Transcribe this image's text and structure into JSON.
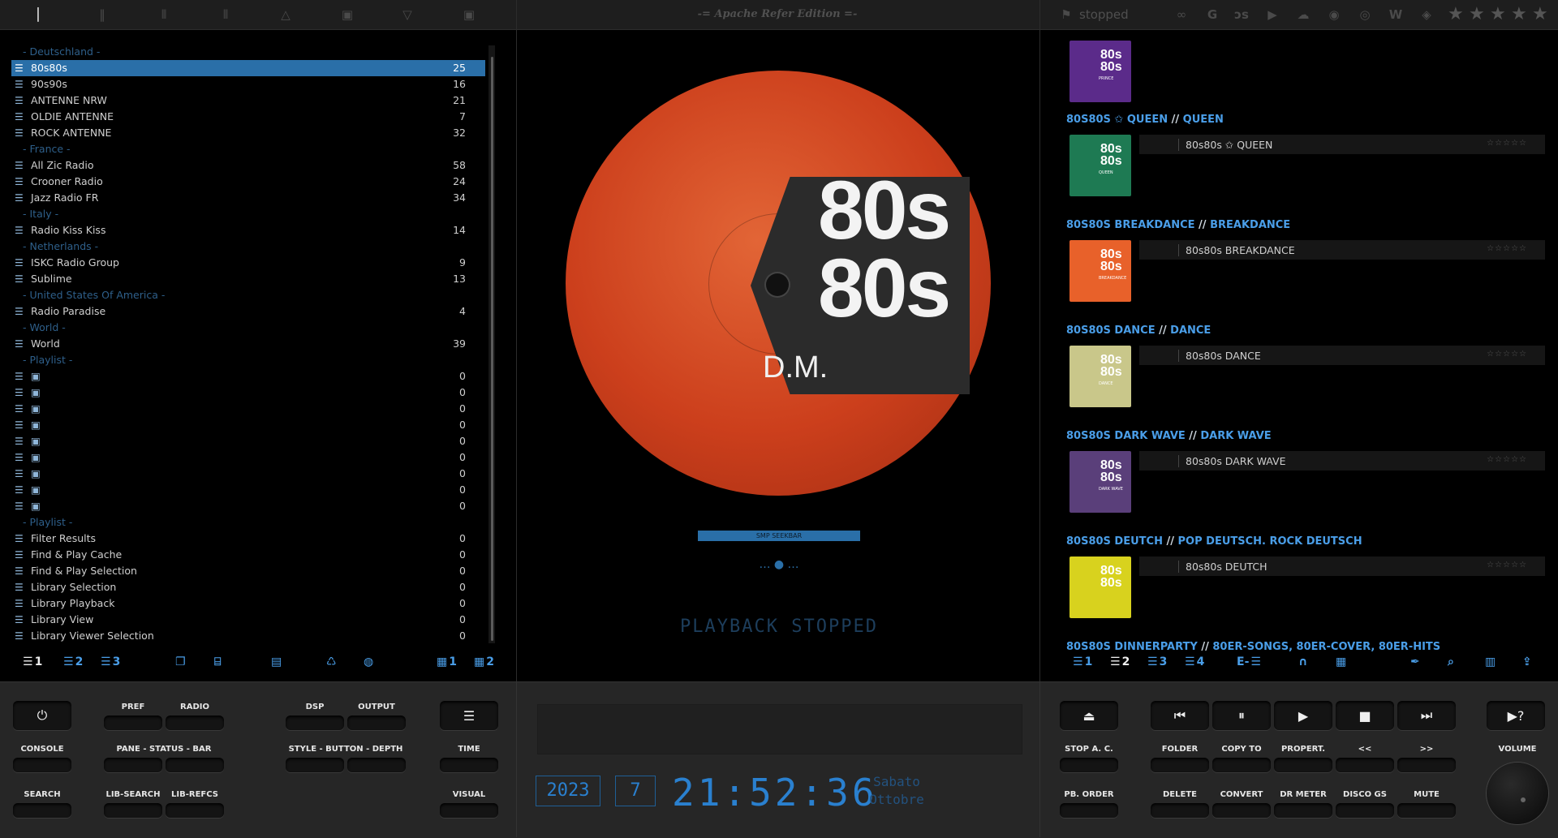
{
  "toolbar": {
    "edition": "-= Apache Refer Edition =-",
    "status": "stopped",
    "left_icons": [
      "layout-1-icon",
      "layout-2-icon",
      "layout-3-icon",
      "layout-4-icon",
      "up-icon",
      "center-icon",
      "down-icon",
      "full-icon"
    ],
    "right_icons": [
      "flag-icon",
      "link-icon",
      "google-icon",
      "lastfm-icon",
      "youtube-icon",
      "soundcloud-icon",
      "spotify-icon",
      "record-icon",
      "wikipedia-icon",
      "podcast-icon"
    ],
    "rating_stars": 5
  },
  "playlist": {
    "rows": [
      {
        "type": "group",
        "label": "- Deutschland -"
      },
      {
        "type": "item",
        "label": "80s80s",
        "count": "25",
        "selected": true
      },
      {
        "type": "item",
        "label": "90s90s",
        "count": "16"
      },
      {
        "type": "item",
        "label": "ANTENNE NRW",
        "count": "21"
      },
      {
        "type": "item",
        "label": "OLDIE ANTENNE",
        "count": "7"
      },
      {
        "type": "item",
        "label": "ROCK ANTENNE",
        "count": "32"
      },
      {
        "type": "group",
        "label": "- France -"
      },
      {
        "type": "item",
        "label": "All Zic Radio",
        "count": "58"
      },
      {
        "type": "item",
        "label": "Crooner Radio",
        "count": "24"
      },
      {
        "type": "item",
        "label": "Jazz Radio FR",
        "count": "34"
      },
      {
        "type": "group",
        "label": "- Italy -"
      },
      {
        "type": "item",
        "label": "Radio Kiss Kiss",
        "count": "14"
      },
      {
        "type": "group",
        "label": "- Netherlands -"
      },
      {
        "type": "item",
        "label": "ISKC Radio Group",
        "count": "9"
      },
      {
        "type": "item",
        "label": "Sublime",
        "count": "13"
      },
      {
        "type": "group",
        "label": "- United States Of America -"
      },
      {
        "type": "item",
        "label": "Radio Paradise",
        "count": "4"
      },
      {
        "type": "group",
        "label": "- World -"
      },
      {
        "type": "item",
        "label": "World",
        "count": "39"
      },
      {
        "type": "group",
        "label": "- Playlist -"
      },
      {
        "type": "item",
        "label": "",
        "count": "0",
        "icon": "radio-icon"
      },
      {
        "type": "item",
        "label": "",
        "count": "0",
        "icon": "record-icon"
      },
      {
        "type": "item",
        "label": "",
        "count": "0",
        "icon": "guitar-icon"
      },
      {
        "type": "item",
        "label": "",
        "count": "0",
        "icon": "headphones-icon"
      },
      {
        "type": "item",
        "label": "",
        "count": "0",
        "icon": "microphone-icon"
      },
      {
        "type": "item",
        "label": "",
        "count": "0",
        "icon": "speaker-icon"
      },
      {
        "type": "item",
        "label": "",
        "count": "0",
        "icon": "clapper-icon"
      },
      {
        "type": "item",
        "label": "",
        "count": "0",
        "icon": "bus-icon"
      },
      {
        "type": "item",
        "label": "",
        "count": "0",
        "icon": "tv-icon"
      },
      {
        "type": "group",
        "label": "- Playlist -"
      },
      {
        "type": "item",
        "label": "Filter Results",
        "count": "0"
      },
      {
        "type": "item",
        "label": "Find & Play Cache",
        "count": "0"
      },
      {
        "type": "item",
        "label": "Find & Play Selection",
        "count": "0"
      },
      {
        "type": "item",
        "label": "Library Selection",
        "count": "0"
      },
      {
        "type": "item",
        "label": "Library Playback",
        "count": "0"
      },
      {
        "type": "item",
        "label": "Library View",
        "count": "0"
      },
      {
        "type": "item",
        "label": "Library Viewer Selection",
        "count": "0"
      }
    ],
    "bottom_buttons": [
      "1",
      "2",
      "3",
      "",
      "",
      "",
      "",
      "",
      "1",
      "2"
    ]
  },
  "center": {
    "cover_big_1": "80s",
    "cover_big_2": "80s",
    "cover_dm": "D.M.",
    "seekbar": "SMP SEEKBAR",
    "status": "PLAYBACK STOPPED"
  },
  "albums": [
    {
      "artist": "",
      "album": "",
      "title": "",
      "thumb_color": "#5b2b8a",
      "thumb_text": "PRINCE"
    },
    {
      "artist": "80S80S ✩ QUEEN",
      "album": "QUEEN",
      "title": "80s80s ✩ QUEEN",
      "thumb_color": "#1e7a53",
      "thumb_text": "QUEEN"
    },
    {
      "artist": "80S80S BREAKDANCE",
      "album": "BREAKDANCE",
      "title": "80s80s BREAKDANCE",
      "thumb_color": "#e8612a",
      "thumb_text": "BREAKDANCE"
    },
    {
      "artist": "80S80S DANCE",
      "album": "DANCE",
      "title": "80s80s DANCE",
      "thumb_color": "#c9c78a",
      "thumb_text": "DANCE"
    },
    {
      "artist": "80S80S DARK WAVE",
      "album": "DARK WAVE",
      "title": "80s80s DARK WAVE",
      "thumb_color": "#5a3f7a",
      "thumb_text": "DARK WAVE"
    },
    {
      "artist": "80S80S DEUTCH",
      "album": "POP DEUTSCH. ROCK DEUTSCH",
      "title": "80s80s DEUTCH",
      "thumb_color": "#d8d21e",
      "thumb_text": ""
    },
    {
      "artist": "80S80S DINNERPARTY",
      "album": "80ER-SONGS, 80ER-COVER, 80ER-HITS",
      "title": "",
      "thumb_color": "#444",
      "thumb_text": ""
    }
  ],
  "rating_text": "☆☆☆☆☆",
  "right_bottom_buttons": [
    "1",
    "2",
    "3",
    "4",
    "E-"
  ],
  "controls": {
    "left": {
      "console": "CONSOLE",
      "search": "SEARCH",
      "pref": "PREF",
      "radio": "RADIO",
      "pane_status_bar": "PANE - STATUS - BAR",
      "lib_search": "LIB-SEARCH",
      "lib_refcs": "LIB-REFCS",
      "dsp": "DSP",
      "output": "OUTPUT",
      "style_button_depth": "STYLE - BUTTON - DEPTH",
      "time": "TIME",
      "visual": "VISUAL"
    },
    "clock": {
      "year": "2023",
      "day": "7",
      "time": "21:52:36",
      "dayname": "Sabato",
      "month": "Ottobre"
    },
    "right": {
      "stop_ac": "STOP A. C.",
      "pb_order": "PB. ORDER",
      "folder": "FOLDER",
      "copy_to": "COPY TO",
      "propert": "PROPERT.",
      "prev": "<<",
      "next": ">>",
      "delete": "DELETE",
      "convert": "CONVERT",
      "dr_meter": "DR METER",
      "disco_gs": "DISCO GS",
      "mute": "MUTE",
      "volume": "VOLUME",
      "help": "▶?"
    }
  }
}
